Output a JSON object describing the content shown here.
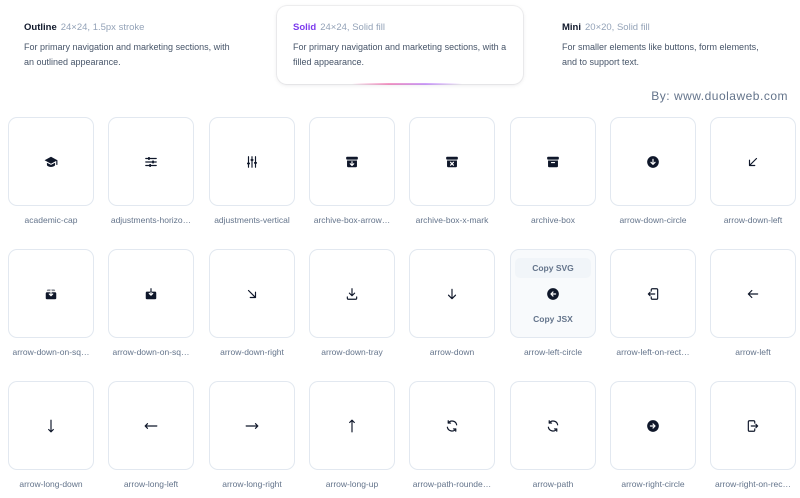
{
  "styles": [
    {
      "name": "Outline",
      "spec": "24×24, 1.5px stroke",
      "desc": "For primary navigation and marketing sections, with an outlined appearance.",
      "active": false
    },
    {
      "name": "Solid",
      "spec": "24×24, Solid fill",
      "desc": "For primary navigation and marketing sections, with a filled appearance.",
      "active": true
    },
    {
      "name": "Mini",
      "spec": "20×20, Solid fill",
      "desc": "For smaller elements like buttons, form elements, and to support text.",
      "active": false
    }
  ],
  "watermark": "By:  www.duolaweb.com",
  "hover": {
    "copy_svg": "Copy SVG",
    "copy_jsx": "Copy JSX"
  },
  "colors": {
    "accent": "#7c3aed",
    "icon": "#0f172a",
    "border": "#e2e8f0",
    "label": "#64748b"
  },
  "icons": [
    {
      "label": "academic-cap",
      "icon": "academic-cap-icon"
    },
    {
      "label": "adjustments-horizo…",
      "icon": "adjustments-horizontal-icon"
    },
    {
      "label": "adjustments-vertical",
      "icon": "adjustments-vertical-icon"
    },
    {
      "label": "archive-box-arrow…",
      "icon": "archive-box-arrow-down-icon"
    },
    {
      "label": "archive-box-x-mark",
      "icon": "archive-box-x-mark-icon"
    },
    {
      "label": "archive-box",
      "icon": "archive-box-icon"
    },
    {
      "label": "arrow-down-circle",
      "icon": "arrow-down-circle-icon"
    },
    {
      "label": "arrow-down-left",
      "icon": "arrow-down-left-icon"
    },
    {
      "label": "arrow-down-on-sq…",
      "icon": "arrow-down-on-square-stack-icon"
    },
    {
      "label": "arrow-down-on-sq…",
      "icon": "arrow-down-on-square-icon"
    },
    {
      "label": "arrow-down-right",
      "icon": "arrow-down-right-icon"
    },
    {
      "label": "arrow-down-tray",
      "icon": "arrow-down-tray-icon"
    },
    {
      "label": "arrow-down",
      "icon": "arrow-down-icon"
    },
    {
      "label": "arrow-left-circle",
      "icon": "arrow-left-circle-icon",
      "hovered": true
    },
    {
      "label": "arrow-left-on-rect…",
      "icon": "arrow-left-on-rectangle-icon"
    },
    {
      "label": "arrow-left",
      "icon": "arrow-left-icon"
    },
    {
      "label": "arrow-long-down",
      "icon": "arrow-long-down-icon"
    },
    {
      "label": "arrow-long-left",
      "icon": "arrow-long-left-icon"
    },
    {
      "label": "arrow-long-right",
      "icon": "arrow-long-right-icon"
    },
    {
      "label": "arrow-long-up",
      "icon": "arrow-long-up-icon"
    },
    {
      "label": "arrow-path-rounde…",
      "icon": "arrow-path-rounded-square-icon"
    },
    {
      "label": "arrow-path",
      "icon": "arrow-path-icon"
    },
    {
      "label": "arrow-right-circle",
      "icon": "arrow-right-circle-icon"
    },
    {
      "label": "arrow-right-on-rec…",
      "icon": "arrow-right-on-rectangle-icon"
    }
  ]
}
